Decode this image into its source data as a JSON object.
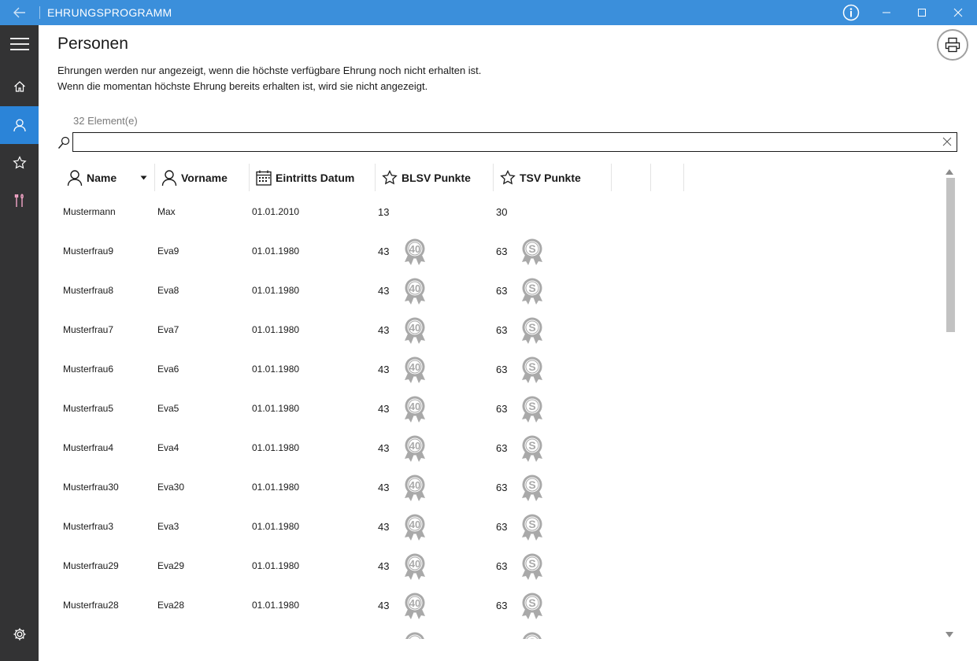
{
  "titlebar": {
    "app_title": "EHRUNGSPROGRAMM",
    "back_icon": "arrow-left-icon",
    "info_icon": "info-icon"
  },
  "sidebar": {
    "items": [
      {
        "icon": "hamburger-menu-icon"
      },
      {
        "icon": "home-icon"
      },
      {
        "icon": "person-icon",
        "active": true
      },
      {
        "icon": "star-icon"
      },
      {
        "icon": "tools-icon"
      },
      {
        "icon": "gear-icon"
      }
    ]
  },
  "page": {
    "title": "Personen",
    "description_line1": "Ehrungen werden nur angezeigt, wenn die höchste verfügbare Ehrung noch nicht erhalten ist.",
    "description_line2": "Wenn die momentan höchste Ehrung bereits erhalten ist, wird sie nicht angezeigt.",
    "print_icon": "printer-icon"
  },
  "search": {
    "count_label": "32 Element(e)",
    "value": "",
    "placeholder": ""
  },
  "table": {
    "columns": [
      {
        "label": "Name",
        "icon": "person-icon",
        "sorted": true
      },
      {
        "label": "Vorname",
        "icon": "person-icon"
      },
      {
        "label": "Eintritts Datum",
        "icon": "calendar-icon"
      },
      {
        "label": "BLSV Punkte",
        "icon": "star-icon"
      },
      {
        "label": "TSV Punkte",
        "icon": "star-icon"
      }
    ],
    "rows": [
      {
        "name": "Mustermann",
        "vorname": "Max",
        "datum": "01.01.2010",
        "blsv": "13",
        "tsv": "30",
        "blsv_medal": "",
        "tsv_medal": ""
      },
      {
        "name": "Musterfrau9",
        "vorname": "Eva9",
        "datum": "01.01.1980",
        "blsv": "43",
        "tsv": "63",
        "blsv_medal": "40",
        "tsv_medal": "S"
      },
      {
        "name": "Musterfrau8",
        "vorname": "Eva8",
        "datum": "01.01.1980",
        "blsv": "43",
        "tsv": "63",
        "blsv_medal": "40",
        "tsv_medal": "S"
      },
      {
        "name": "Musterfrau7",
        "vorname": "Eva7",
        "datum": "01.01.1980",
        "blsv": "43",
        "tsv": "63",
        "blsv_medal": "40",
        "tsv_medal": "S"
      },
      {
        "name": "Musterfrau6",
        "vorname": "Eva6",
        "datum": "01.01.1980",
        "blsv": "43",
        "tsv": "63",
        "blsv_medal": "40",
        "tsv_medal": "S"
      },
      {
        "name": "Musterfrau5",
        "vorname": "Eva5",
        "datum": "01.01.1980",
        "blsv": "43",
        "tsv": "63",
        "blsv_medal": "40",
        "tsv_medal": "S"
      },
      {
        "name": "Musterfrau4",
        "vorname": "Eva4",
        "datum": "01.01.1980",
        "blsv": "43",
        "tsv": "63",
        "blsv_medal": "40",
        "tsv_medal": "S"
      },
      {
        "name": "Musterfrau30",
        "vorname": "Eva30",
        "datum": "01.01.1980",
        "blsv": "43",
        "tsv": "63",
        "blsv_medal": "40",
        "tsv_medal": "S"
      },
      {
        "name": "Musterfrau3",
        "vorname": "Eva3",
        "datum": "01.01.1980",
        "blsv": "43",
        "tsv": "63",
        "blsv_medal": "40",
        "tsv_medal": "S"
      },
      {
        "name": "Musterfrau29",
        "vorname": "Eva29",
        "datum": "01.01.1980",
        "blsv": "43",
        "tsv": "63",
        "blsv_medal": "40",
        "tsv_medal": "S"
      },
      {
        "name": "Musterfrau28",
        "vorname": "Eva28",
        "datum": "01.01.1980",
        "blsv": "43",
        "tsv": "63",
        "blsv_medal": "40",
        "tsv_medal": "S"
      },
      {
        "name": "",
        "vorname": "",
        "datum": "",
        "blsv": "",
        "tsv": "",
        "blsv_medal": "40",
        "tsv_medal": "S"
      }
    ]
  },
  "colors": {
    "titlebar": "#3b8fdb",
    "sidebar": "#333334",
    "active_nav": "#2b84d8",
    "medal": "#a9a9a9"
  }
}
